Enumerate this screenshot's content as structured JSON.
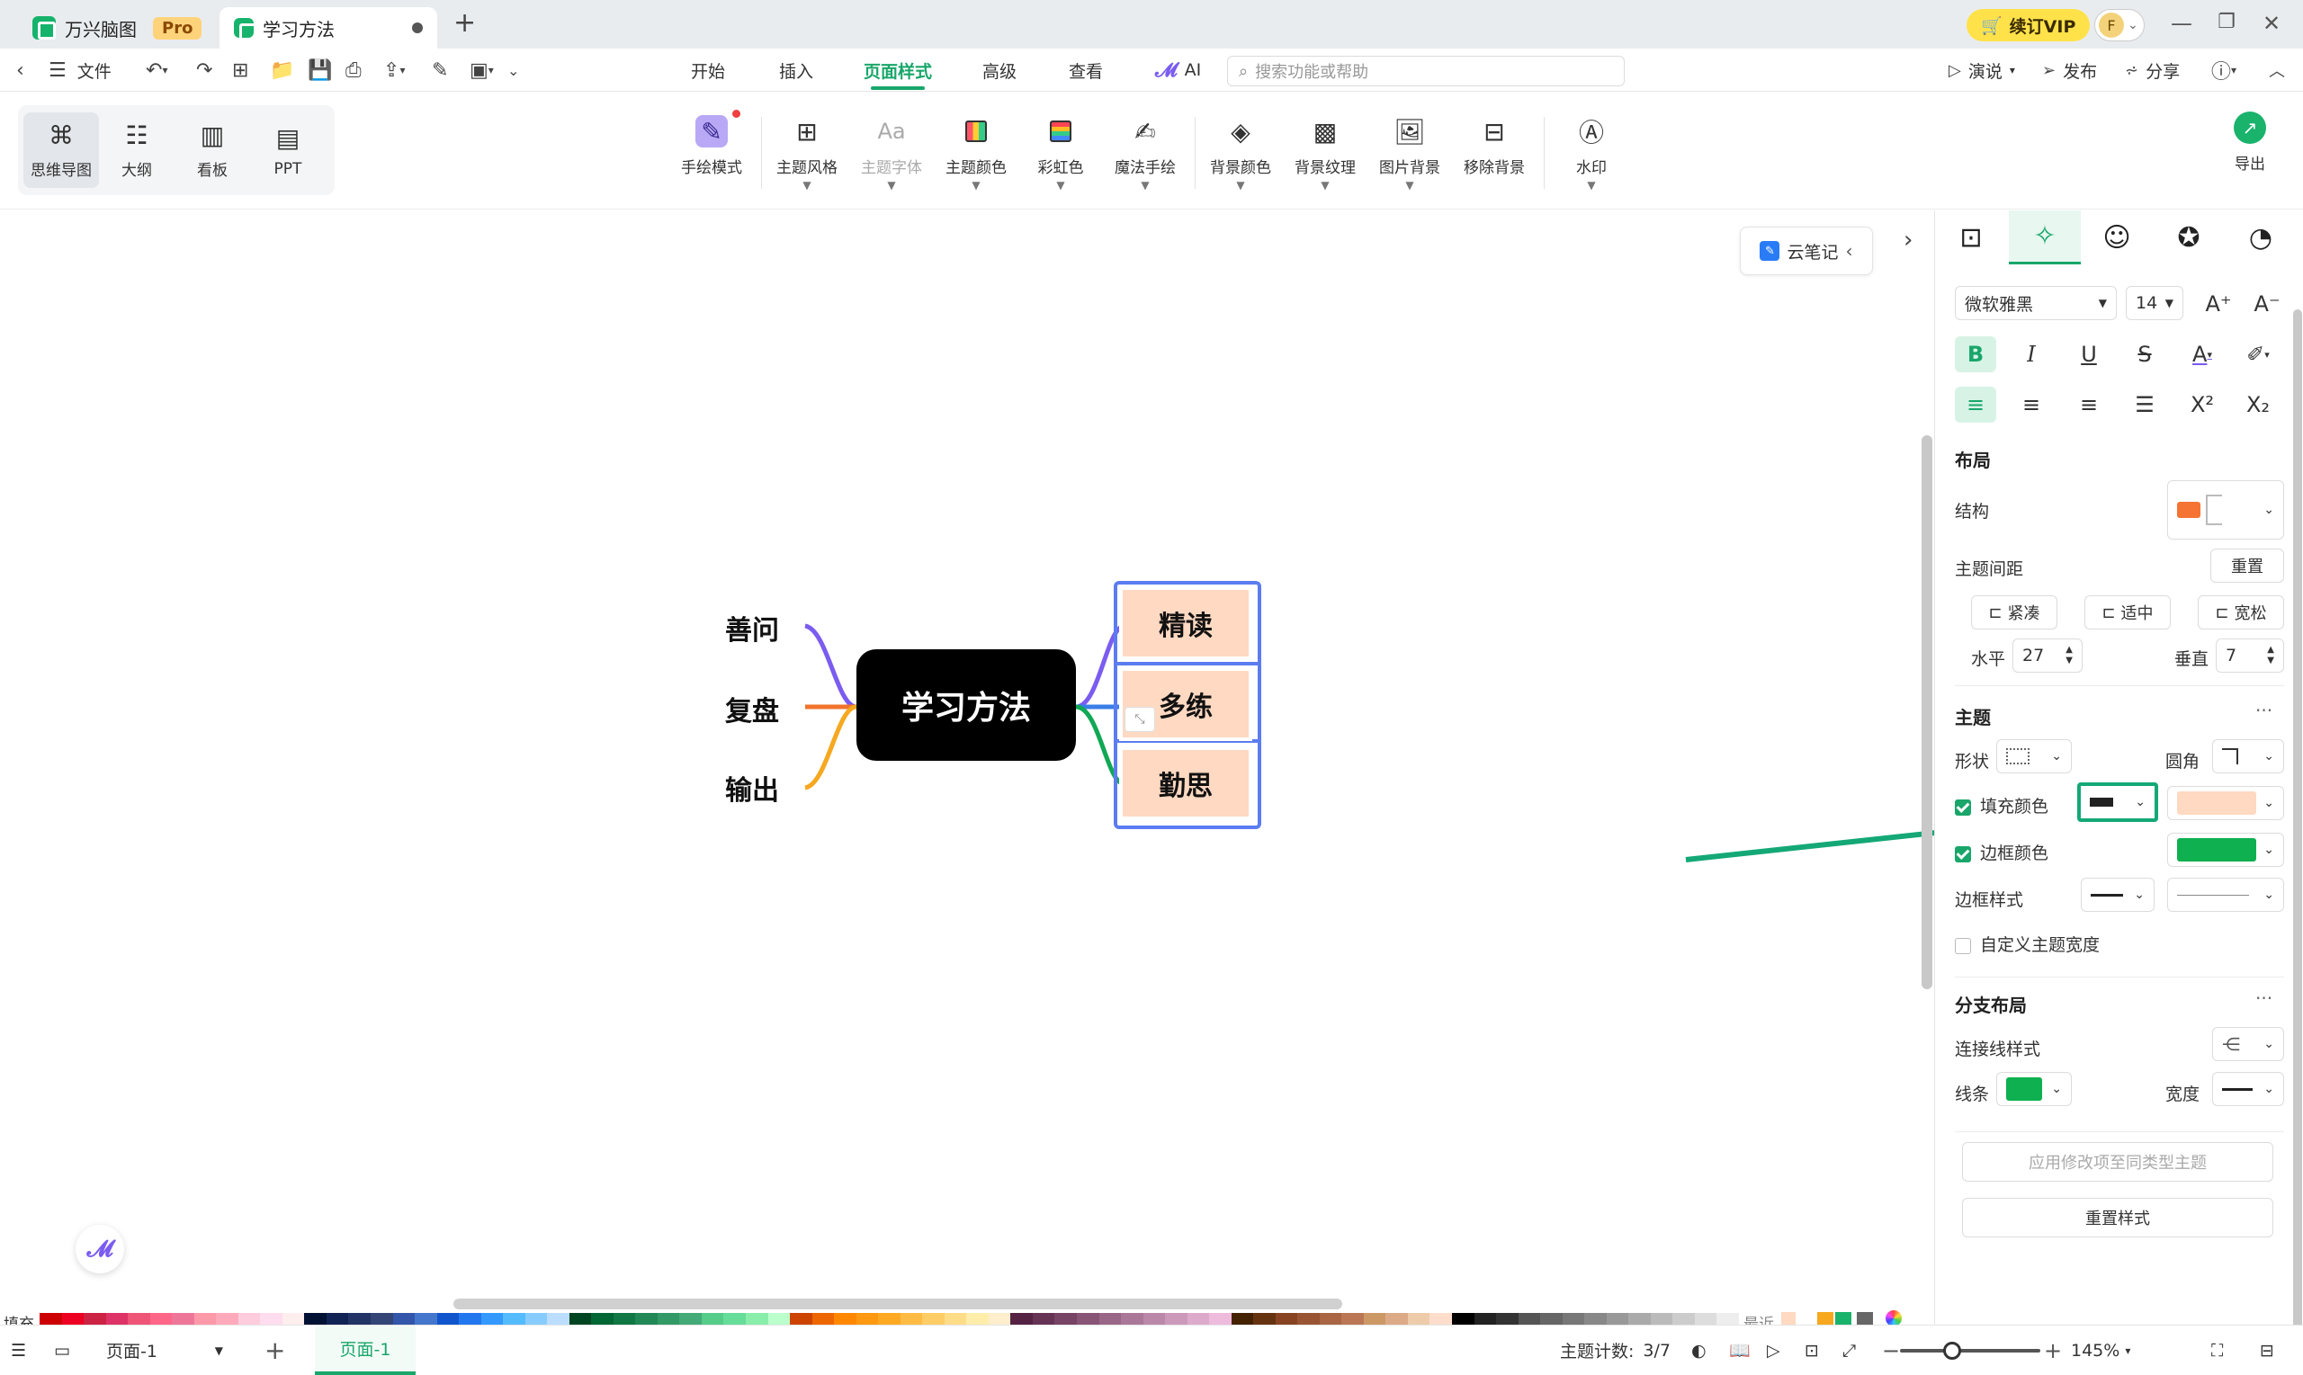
{
  "tabs": [
    {
      "label": "万兴脑图",
      "badge": "Pro"
    },
    {
      "label": "学习方法"
    }
  ],
  "tabbar": {
    "add": "+",
    "vip_label": "续订VIP",
    "avatar": "F"
  },
  "menubar": {
    "file": "文件",
    "items": [
      "开始",
      "插入",
      "页面样式",
      "高级",
      "查看",
      "AI"
    ],
    "active": "页面样式",
    "search_placeholder": "搜索功能或帮助",
    "right": [
      "演说",
      "发布",
      "分享"
    ]
  },
  "views": [
    "思维导图",
    "大纲",
    "看板",
    "PPT"
  ],
  "ribbon": [
    "手绘模式",
    "主题风格",
    "主题字体",
    "主题颜色",
    "彩虹色",
    "魔法手绘",
    "背景颜色",
    "背景纹理",
    "图片背景",
    "移除背景",
    "水印"
  ],
  "export_label": "导出",
  "cloud_note": "云笔记",
  "mindmap": {
    "central": "学习方法",
    "left": [
      "善问",
      "复盘",
      "输出"
    ],
    "right": [
      "精读",
      "多练",
      "勤思"
    ]
  },
  "panel": {
    "font": "微软雅黑",
    "size": "14",
    "layout_title": "布局",
    "structure": "结构",
    "spacing": "主题间距",
    "reset": "重置",
    "spacing_opts": [
      "紧凑",
      "适中",
      "宽松"
    ],
    "horizontal": "水平",
    "h_val": "27",
    "vertical": "垂直",
    "v_val": "7",
    "topic_title": "主题",
    "shape": "形状",
    "corner": "圆角",
    "fill": "填充颜色",
    "border": "边框颜色",
    "border_style": "边框样式",
    "custom_width": "自定义主题宽度",
    "branch_title": "分支布局",
    "line_style": "连接线样式",
    "line": "线条",
    "width": "宽度",
    "apply": "应用修改项至同类型主题",
    "reset_style": "重置样式",
    "more": "···"
  },
  "palette": {
    "label": "填充",
    "recent": "最近"
  },
  "status": {
    "page_select": "页面-1",
    "page_tab": "页面-1",
    "count_label": "主题计数:",
    "count": "3/7",
    "zoom": "145%"
  },
  "colors": {
    "accent": "#19a66a",
    "fill": "#ffd9c2",
    "border": "#0fb04f",
    "selection": "#5b7cf0",
    "arrow": "#14a877"
  }
}
